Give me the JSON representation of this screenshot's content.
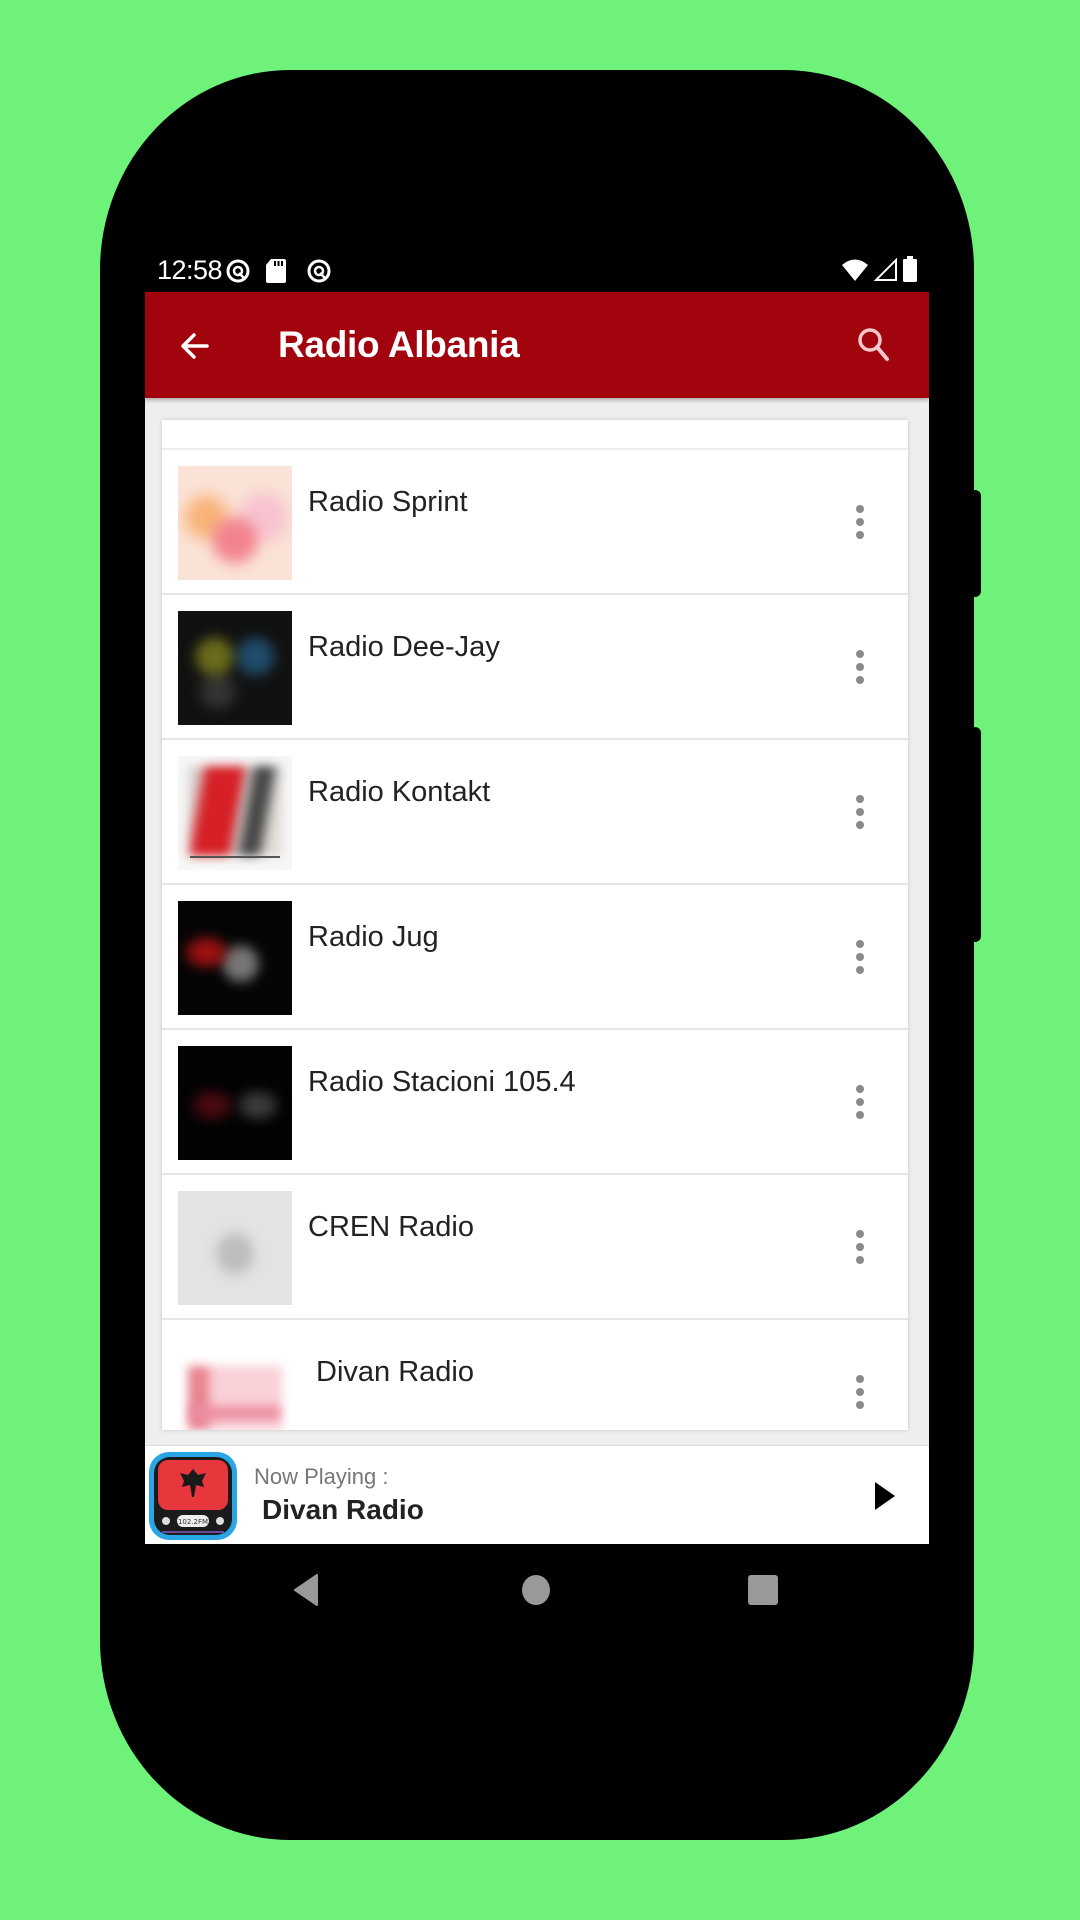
{
  "status_bar": {
    "time": "12:58",
    "left_icons": [
      "data-saver-icon",
      "sd-card-icon",
      "data-saver-icon"
    ],
    "right_icons": [
      "wifi-icon",
      "cell-signal-icon",
      "battery-icon"
    ]
  },
  "app_bar": {
    "title": "Radio Albania",
    "back_icon": "arrow-left-icon",
    "search_icon": "search-icon",
    "color": "#a1040d"
  },
  "stations": [
    {
      "name": "Radio Sprint",
      "thumb": "sprint"
    },
    {
      "name": "Radio Dee-Jay",
      "thumb": "deejay"
    },
    {
      "name": "Radio Kontakt",
      "thumb": "kontakt"
    },
    {
      "name": "Radio Jug",
      "thumb": "jug"
    },
    {
      "name": "Radio Stacioni 105.4",
      "thumb": "stacioni"
    },
    {
      "name": "CREN Radio",
      "thumb": "cren"
    },
    {
      "name": "Divan Radio",
      "thumb": "divan"
    }
  ],
  "player": {
    "label": "Now Playing :",
    "title": "Divan Radio",
    "play_icon": "play-icon",
    "logo_text": "102.2FM"
  },
  "nav_bar": {
    "icons": [
      "nav-back-icon",
      "nav-home-icon",
      "nav-recents-icon"
    ]
  }
}
